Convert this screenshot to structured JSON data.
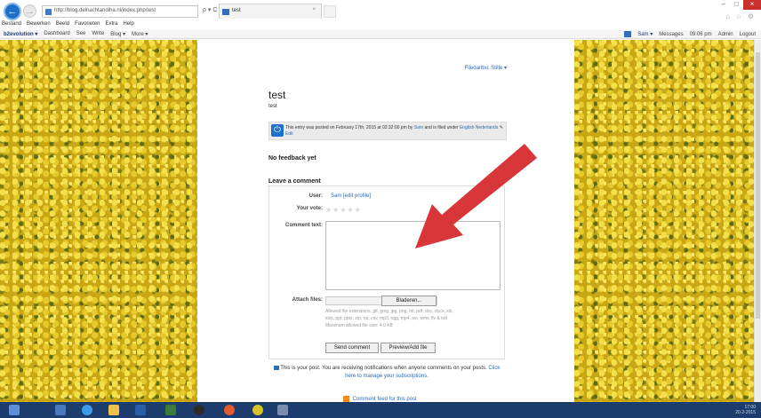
{
  "browser": {
    "url": "http://blog.delnachtandiha.nl/index.php/test",
    "address_controls": "ρ ▾ C",
    "tab_title": "test",
    "tab_close": "×",
    "window_controls": [
      "–",
      "□",
      "×"
    ],
    "tools_icons": "⌂ ☆ ⚙",
    "menu": [
      "Bestand",
      "Bewerken",
      "Beeld",
      "Favorieten",
      "Extra",
      "Help"
    ]
  },
  "b2evo_toolbar": {
    "left": [
      "b2evolution ▾",
      "Dashboard",
      "See",
      "Write",
      "Blog ▾",
      "More ▾"
    ],
    "right": [
      "Sam ▾",
      "Messages",
      "09:06 pm",
      "Admin",
      "Logout"
    ]
  },
  "blog": {
    "filter_link": "Filedaribu: Stille ▾",
    "post_title": "test",
    "post_body": "test",
    "meta": {
      "prefix": "This entry was posted on February 17th, 2015 at 02:32:00 pm by",
      "author": "Sam",
      "middle": "and is filed under",
      "categories": "English Nederlands",
      "edit": "Edit"
    },
    "no_feedback": "No feedback yet",
    "leave_comment": "Leave a comment",
    "form": {
      "user_label": "User:",
      "user_value": "Sam [edit profile]",
      "vote_label": "Your vote:",
      "stars": "★★★★★",
      "comment_label": "Comment text:",
      "attach_label": "Attach files:",
      "browse_button": "Bladeren...",
      "allowed_line1": "Allowed file extensions: gif, jpeg, jpg, png, txt, pdf, doc, docx, xls,",
      "allowed_line2": "xlsx, ppt, pptx, zip, rar, csv, mp3, ogg, mp4, avi, wmv, flv & tod",
      "allowed_line3": "Maximum allowed file size: 4.0 KB",
      "send_button": "Send comment",
      "preview_button": "Preview/Add file"
    },
    "notification": "This is your post. You are receiving notifications when anyone comments on your posts.",
    "manage_link": "Click here to manage your subscriptions.",
    "feed_link": "Comment feed for this post"
  },
  "taskbar": {
    "clock_time": "17:00",
    "clock_date": "20-2-2015"
  },
  "colors": {
    "arrow": "#d9363a",
    "taskbar": "#1c3c6e",
    "link": "#2a6bb5"
  }
}
